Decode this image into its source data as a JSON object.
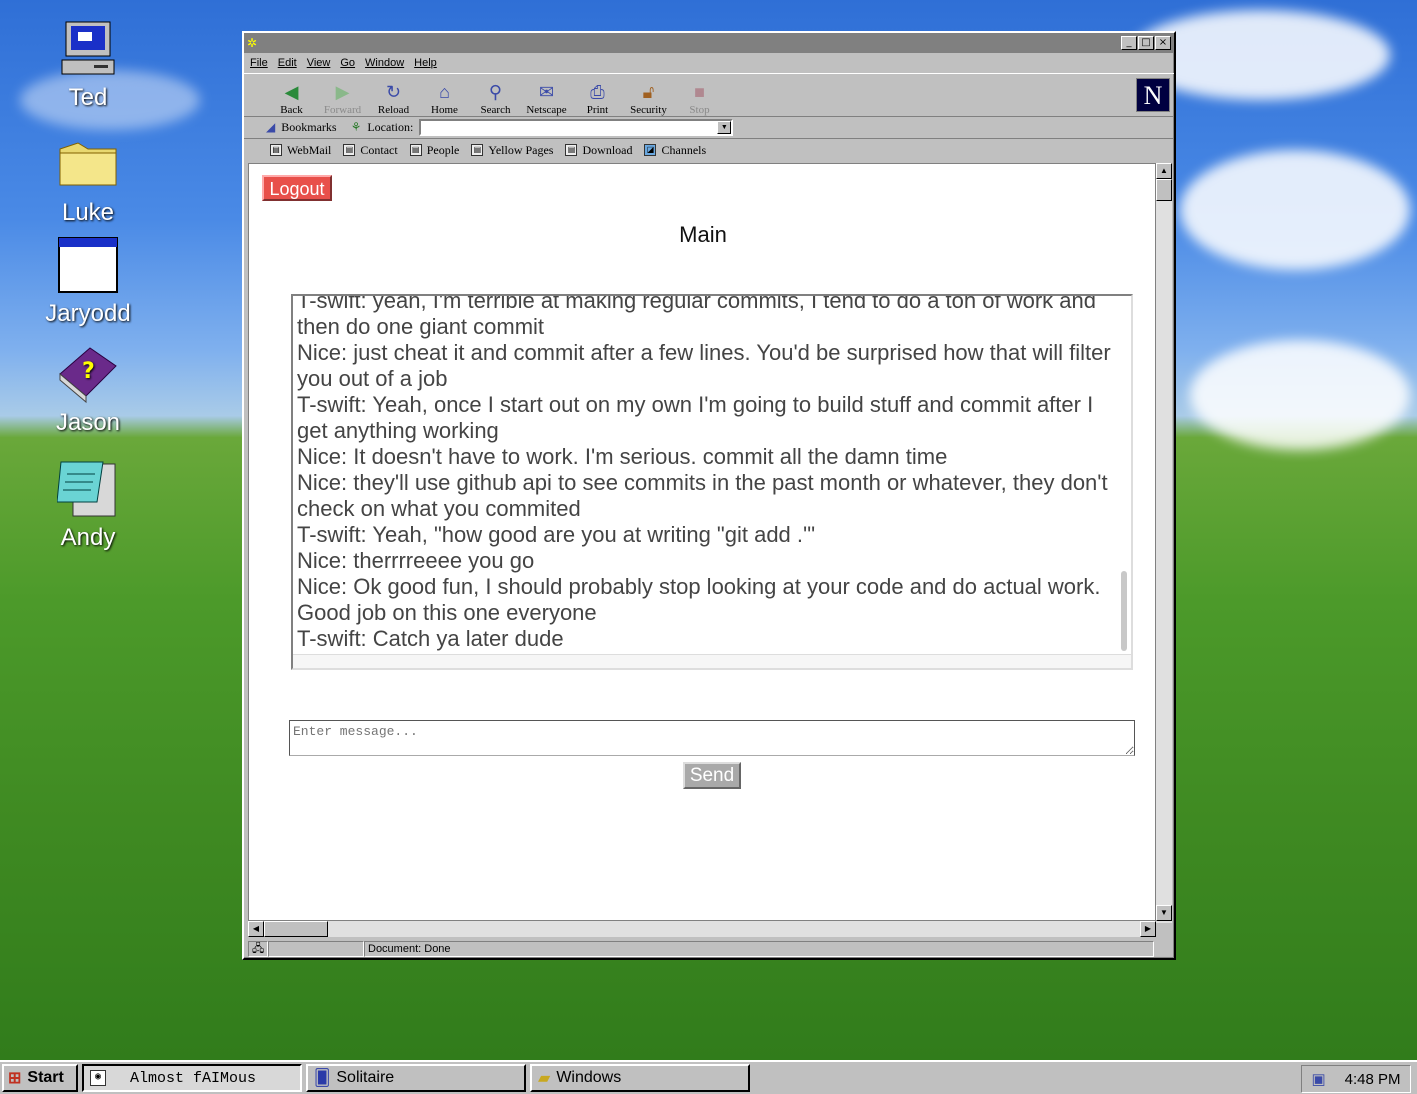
{
  "desktop": {
    "icons": [
      {
        "label": "Ted",
        "icon": "computer-icon"
      },
      {
        "label": "Luke",
        "icon": "folder-icon"
      },
      {
        "label": "Jaryodd",
        "icon": "window-icon"
      },
      {
        "label": "Jason",
        "icon": "help-book-icon"
      },
      {
        "label": "Andy",
        "icon": "notepad-icon"
      }
    ]
  },
  "window": {
    "menu": [
      "File",
      "Edit",
      "View",
      "Go",
      "Window",
      "Help"
    ],
    "nav_buttons": [
      {
        "label": "Back",
        "icon": "back-arrow-icon",
        "enabled": true
      },
      {
        "label": "Forward",
        "icon": "forward-arrow-icon",
        "enabled": false
      },
      {
        "label": "Reload",
        "icon": "reload-icon",
        "enabled": true
      },
      {
        "label": "Home",
        "icon": "home-icon",
        "enabled": true
      },
      {
        "label": "Search",
        "icon": "search-icon",
        "enabled": true
      },
      {
        "label": "Netscape",
        "icon": "netscape-icon",
        "enabled": true
      },
      {
        "label": "Print",
        "icon": "print-icon",
        "enabled": true
      },
      {
        "label": "Security",
        "icon": "lock-icon",
        "enabled": true
      },
      {
        "label": "Stop",
        "icon": "stop-icon",
        "enabled": false
      }
    ],
    "bookmarks_label": "Bookmarks",
    "location_label": "Location:",
    "location_value": "",
    "personal_toolbar": [
      "WebMail",
      "Contact",
      "People",
      "Yellow Pages",
      "Download",
      "Channels"
    ],
    "status_text": "Document: Done",
    "logo_letter": "N"
  },
  "page": {
    "logout_label": "Logout",
    "title": "Main",
    "messages": [
      "T-swift: yeah, I'm terrible at making regular commits, I tend to do a ton of work and then do one giant commit",
      "Nice: just cheat it and commit after a few lines. You'd be surprised how that will filter you out of a job",
      "T-swift: Yeah, once I start out on my own I'm going to build stuff and commit after I get anything working",
      "Nice: It doesn't have to work. I'm serious. commit all the damn time",
      "Nice: they'll use github api to see commits in the past month or whatever, they don't check on what you commited",
      "T-swift: Yeah, \"how good are you at writing \"git add .'\"",
      "Nice: therrrreeee you go",
      "Nice: Ok good fun, I should probably stop looking at your code and do actual work. Good job on this one everyone",
      "T-swift: Catch ya later dude"
    ],
    "input_placeholder": "Enter message...",
    "send_label": "Send",
    "colors": {
      "logout_bg": "#e8504a",
      "send_bg": "#a9a9a9"
    }
  },
  "taskbar": {
    "start_label": "Start",
    "tasks": [
      {
        "label": "Almost fAIMous",
        "icon": "aim-icon",
        "active": true
      },
      {
        "label": "Solitaire",
        "icon": "solitaire-icon",
        "active": false
      },
      {
        "label": "Windows",
        "icon": "folder-icon",
        "active": false
      }
    ],
    "time": "4:48 PM"
  }
}
